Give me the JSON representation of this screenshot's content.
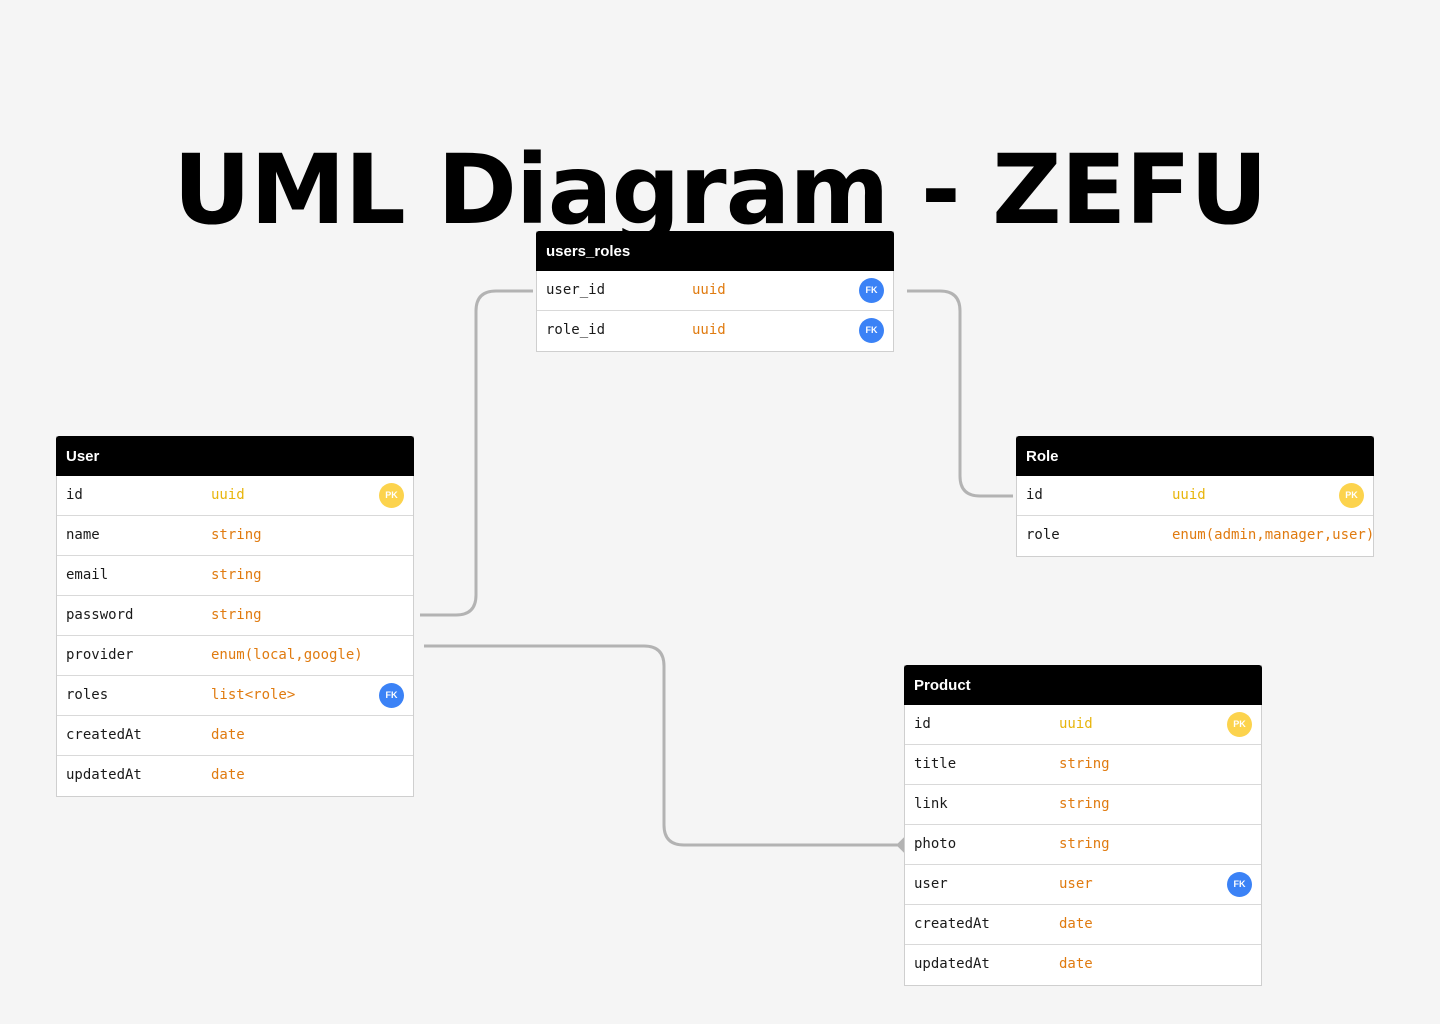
{
  "title": "UML Diagram - ZEFU",
  "colors": {
    "header_bg": "#000000",
    "type_text": "#e07b10",
    "pk_type_text": "#e8b50c",
    "fk_badge": "#3b82f6",
    "pk_badge": "#fcd34d",
    "connector": "#b3b3b3"
  },
  "tables": {
    "users_roles": {
      "name": "users_roles",
      "rows": [
        {
          "field": "user_id",
          "type": "uuid",
          "badge": "FK"
        },
        {
          "field": "role_id",
          "type": "uuid",
          "badge": "FK"
        }
      ]
    },
    "user": {
      "name": "User",
      "rows": [
        {
          "field": "id",
          "type": "uuid",
          "badge": "PK"
        },
        {
          "field": "name",
          "type": "string"
        },
        {
          "field": "email",
          "type": "string"
        },
        {
          "field": "password",
          "type": "string"
        },
        {
          "field": "provider",
          "type": "enum(local,google)"
        },
        {
          "field": "roles",
          "type": "list<role>",
          "badge": "FK"
        },
        {
          "field": "createdAt",
          "type": "date"
        },
        {
          "field": "updatedAt",
          "type": "date"
        }
      ]
    },
    "role": {
      "name": "Role",
      "rows": [
        {
          "field": "id",
          "type": "uuid",
          "badge": "PK"
        },
        {
          "field": "role",
          "type": "enum(admin,manager,user)"
        }
      ]
    },
    "product": {
      "name": "Product",
      "rows": [
        {
          "field": "id",
          "type": "uuid",
          "badge": "PK"
        },
        {
          "field": "title",
          "type": "string"
        },
        {
          "field": "link",
          "type": "string"
        },
        {
          "field": "photo",
          "type": "string"
        },
        {
          "field": "user",
          "type": "user",
          "badge": "FK"
        },
        {
          "field": "createdAt",
          "type": "date"
        },
        {
          "field": "updatedAt",
          "type": "date"
        }
      ]
    }
  }
}
